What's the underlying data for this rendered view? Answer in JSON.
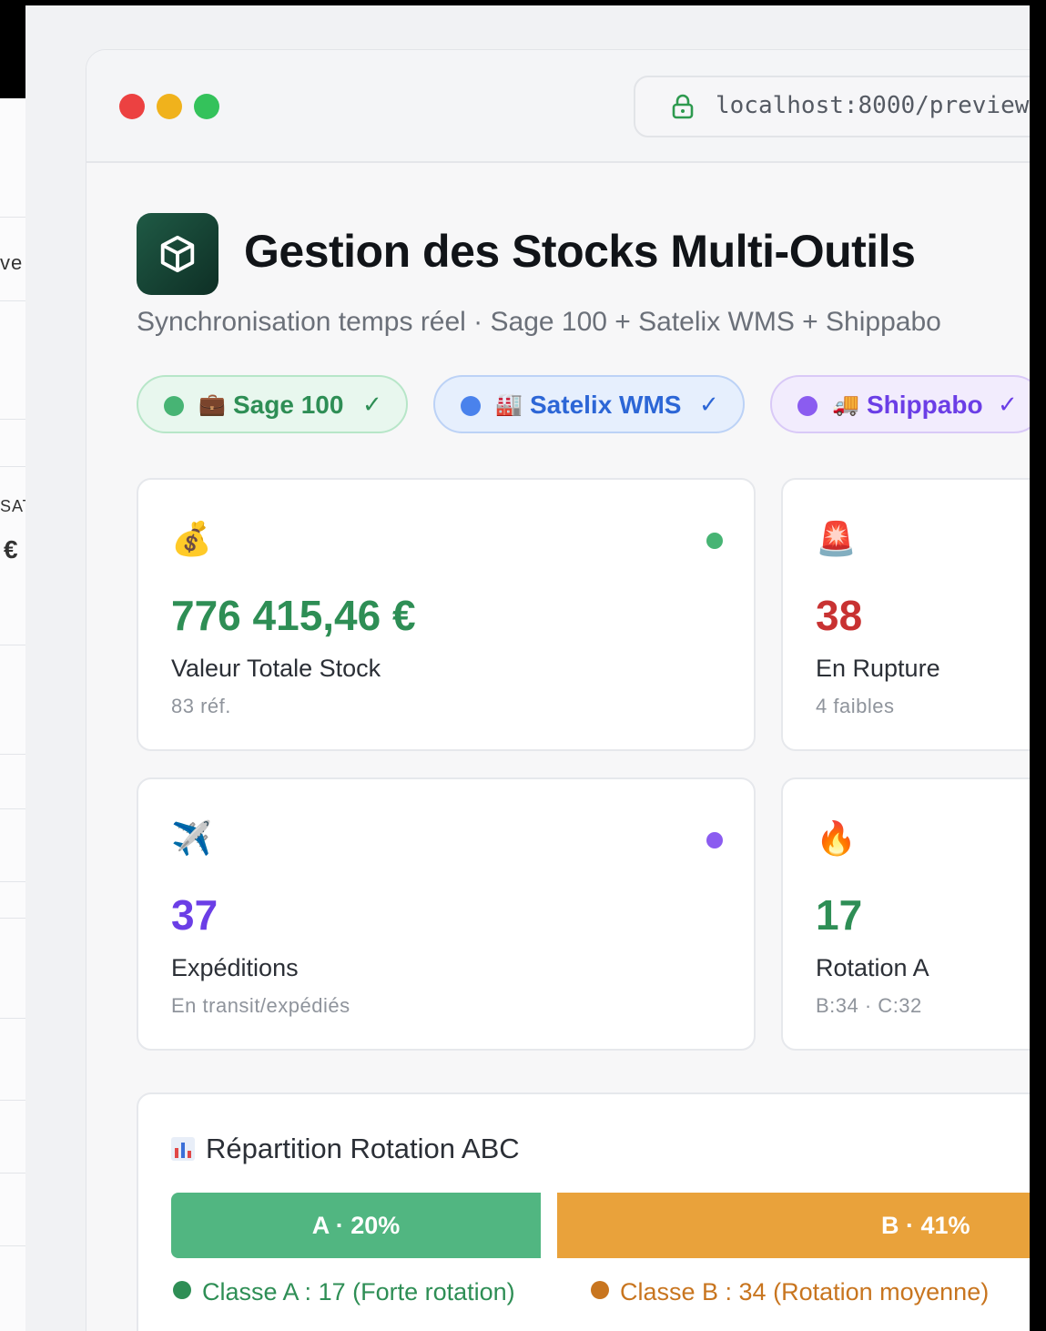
{
  "background_window": {
    "partial_texts": [
      "ve",
      "SAT",
      "€"
    ]
  },
  "browser": {
    "url": "localhost:8000/preview",
    "lock_icon": "lock-icon"
  },
  "header": {
    "logo_icon": "cube-icon",
    "title": "Gestion des Stocks Multi-Outils",
    "subtitle": "Synchronisation temps réel · Sage 100 + Satelix WMS + Shippabo"
  },
  "integrations": [
    {
      "icon": "💼",
      "label": "Sage 100",
      "check": "✓",
      "color": "#47b474"
    },
    {
      "icon": "🏭",
      "label": "Satelix WMS",
      "check": "✓",
      "color": "#4a82ec"
    },
    {
      "icon": "🚚",
      "label": "Shippabo",
      "check": "✓",
      "color": "#8b5cf0"
    }
  ],
  "kpis": [
    {
      "icon": "💰",
      "value": "776 415,46 €",
      "label": "Valeur Totale Stock",
      "sub": "83 réf.",
      "color": "#2e8e55",
      "dot": "#47b474"
    },
    {
      "icon": "🚨",
      "value": "38",
      "label": "En Rupture",
      "sub": "4 faibles",
      "color": "#c83232"
    },
    {
      "icon": "✈️",
      "value": "37",
      "label": "Expéditions",
      "sub": "En transit/expédiés",
      "color": "#6b3ee6",
      "dot": "#8b5cf0"
    },
    {
      "icon": "🔥",
      "value": "17",
      "label": "Rotation A",
      "sub": "B:34 · C:32",
      "color": "#2e8e55"
    }
  ],
  "abc": {
    "title": "Répartition Rotation ABC",
    "title_icon": "bar-chart-icon",
    "bars": [
      {
        "label": "A · 20%",
        "percent": 20,
        "color": "#51b681"
      },
      {
        "label": "B · 41%",
        "percent": 41,
        "color": "#e9a23b"
      }
    ],
    "legend": [
      {
        "label": "Classe A : 17 (Forte rotation)",
        "color": "#2e8e55"
      },
      {
        "label": "Classe B : 34 (Rotation moyenne)",
        "color": "#c8751f"
      }
    ]
  }
}
